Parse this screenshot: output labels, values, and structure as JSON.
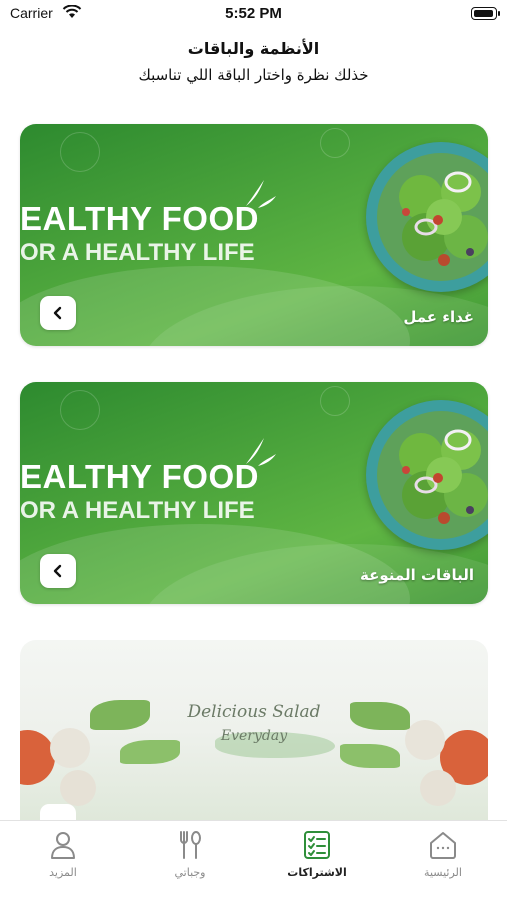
{
  "status_bar": {
    "carrier": "Carrier",
    "time": "5:52 PM"
  },
  "header": {
    "title": "الأنظمة والباقات",
    "subtitle": "خذلك نظرة واختار الباقة اللي تناسبك"
  },
  "cards": [
    {
      "banner_line1": "EALTHY FOOD",
      "banner_line2": "OR A HEALTHY LIFE",
      "label": "غداء عمل"
    },
    {
      "banner_line1": "EALTHY FOOD",
      "banner_line2": "OR A HEALTHY LIFE",
      "label": "الباقات المنوعة"
    },
    {
      "script_line1": "Delicious Salad",
      "script_line2": "Everyday"
    }
  ],
  "tab_bar": {
    "items": [
      {
        "label": "المزيد",
        "icon": "person-icon"
      },
      {
        "label": "وجباتي",
        "icon": "fork-spoon-icon"
      },
      {
        "label": "الاشتراكات",
        "icon": "checklist-icon"
      },
      {
        "label": "الرئيسية",
        "icon": "home-icon"
      }
    ],
    "active_index": 2
  },
  "colors": {
    "accent_green": "#2f8f3a",
    "card_green": "#4aa33b",
    "plate_teal": "#3d9e9e"
  }
}
